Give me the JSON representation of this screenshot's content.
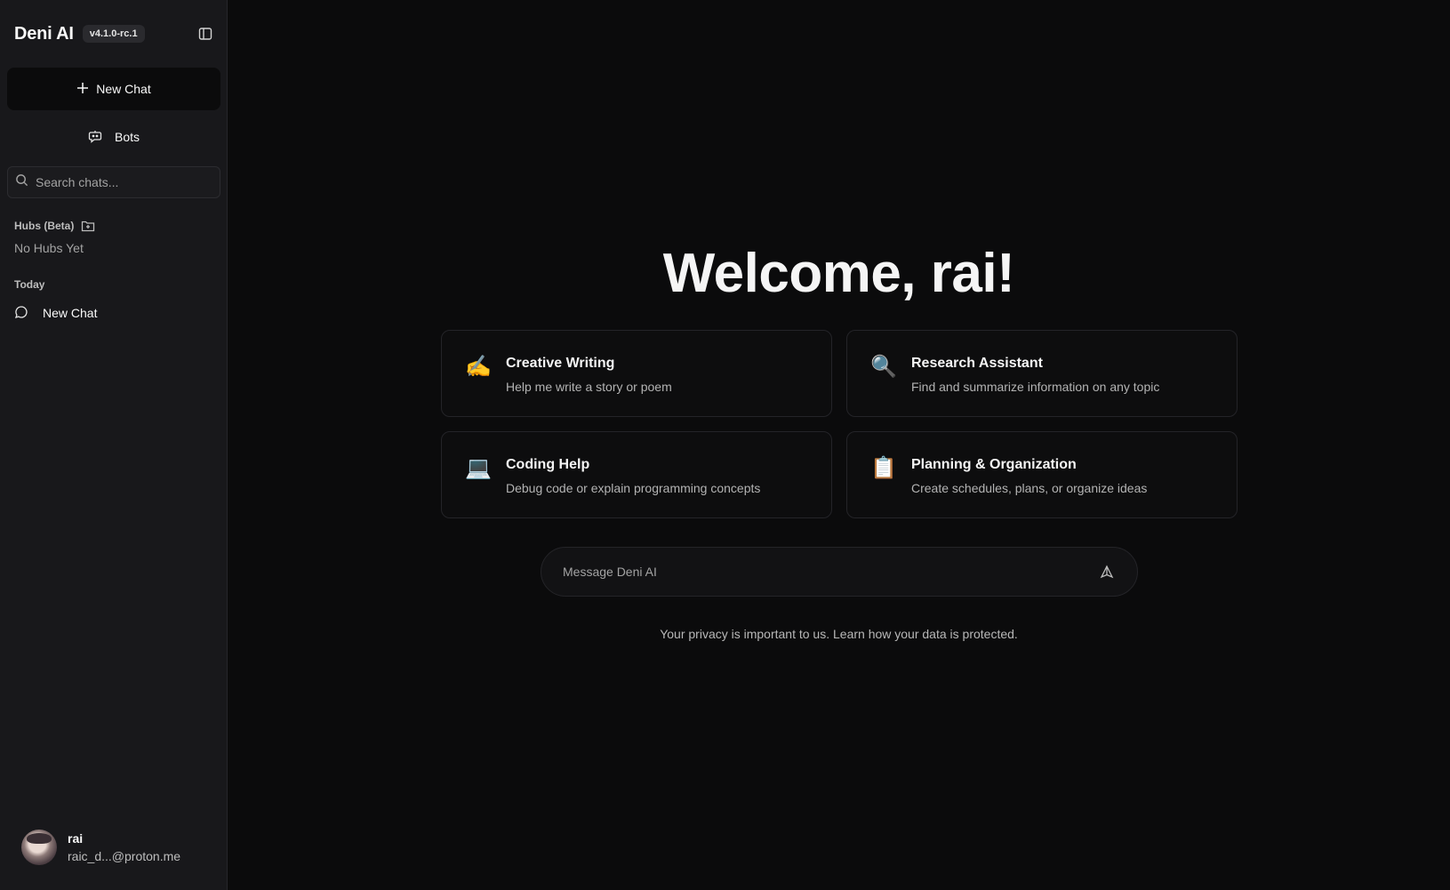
{
  "sidebar": {
    "brand": "Deni AI",
    "version": "v4.1.0-rc.1",
    "new_chat_label": "New Chat",
    "bots_label": "Bots",
    "search_placeholder": "Search chats...",
    "hubs_label": "Hubs (Beta)",
    "hubs_empty": "No Hubs Yet",
    "section_today": "Today",
    "chats": [
      {
        "label": "New Chat",
        "icon": "chat-bubble-icon"
      }
    ],
    "user": {
      "name": "rai",
      "email": "raic_d...@proton.me"
    }
  },
  "main": {
    "welcome": "Welcome, rai!",
    "cards": [
      {
        "emoji": "✍️",
        "title": "Creative Writing",
        "desc": "Help me write a story or poem"
      },
      {
        "emoji": "🔍",
        "title": "Research Assistant",
        "desc": "Find and summarize information on any topic"
      },
      {
        "emoji": "💻",
        "title": "Coding Help",
        "desc": "Debug code or explain programming concepts"
      },
      {
        "emoji": "📋",
        "title": "Planning & Organization",
        "desc": "Create schedules, plans, or organize ideas"
      }
    ],
    "composer_placeholder": "Message Deni AI",
    "privacy_text": "Your privacy is important to us.",
    "privacy_link": "Learn how your data is protected."
  }
}
